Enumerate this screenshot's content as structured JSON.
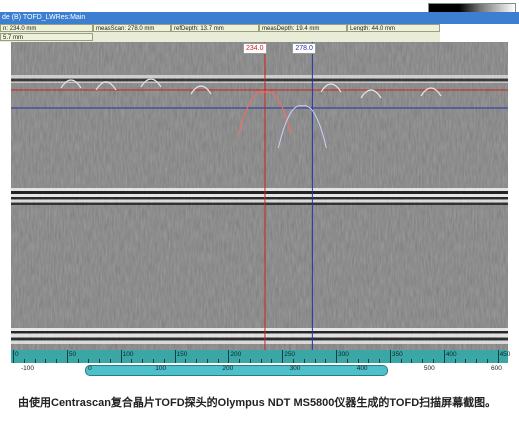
{
  "window": {
    "title": "de (B) TOFD_LWRes:Main"
  },
  "info": {
    "cells": [
      {
        "text": "n: 234.0 mm"
      },
      {
        "text": "measScan: 278.0 mm"
      },
      {
        "text": "refDepth: 13.7 mm"
      },
      {
        "text": "measDepth: 19.4 mm"
      },
      {
        "text": "Length: 44.0 mm"
      },
      {
        "text": "5.7 mm"
      }
    ]
  },
  "cursors": {
    "ref": {
      "label": "234.0",
      "value": 234.0,
      "color": "#cc2222"
    },
    "meas": {
      "label": "278.0",
      "value": 278.0,
      "color": "#2233aa"
    }
  },
  "scan_axis": {
    "ticks": [
      "0",
      "50",
      "100",
      "150",
      "200",
      "250",
      "300",
      "350",
      "400",
      "450"
    ]
  },
  "scroll_axis": {
    "ticks": [
      "-100",
      "0",
      "100",
      "200",
      "300",
      "400",
      "500",
      "600"
    ]
  },
  "caption": "由使用Centrascan复合晶片TOFD探头的Olympus NDT MS5800仪器生成的TOFD扫描屏幕截图。"
}
